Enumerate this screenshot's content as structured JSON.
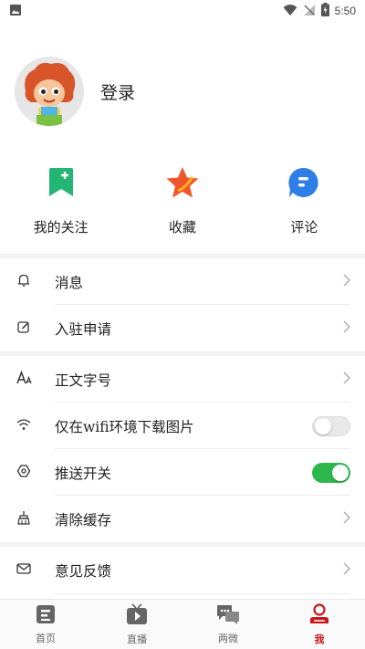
{
  "status": {
    "time": "5:50"
  },
  "profile": {
    "login_label": "登录"
  },
  "quick_actions": [
    {
      "label": "我的关注",
      "icon": "bookmark-plus-icon",
      "color": "#22b573"
    },
    {
      "label": "收藏",
      "icon": "star-icon",
      "color": "#f0552b"
    },
    {
      "label": "评论",
      "icon": "comment-icon",
      "color": "#2d7ee6"
    }
  ],
  "menu": {
    "messages": {
      "label": "消息",
      "icon": "bell-icon"
    },
    "settle": {
      "label": "入驻申请",
      "icon": "edit-icon"
    },
    "font_size": {
      "label": "正文字号",
      "icon": "font-size-icon"
    },
    "wifi_images": {
      "label": "仅在wifi环境下载图片",
      "icon": "wifi-icon",
      "enabled": false
    },
    "push": {
      "label": "推送开关",
      "icon": "hexagon-icon",
      "enabled": true
    },
    "clear_cache": {
      "label": "清除缓存",
      "icon": "broom-icon"
    },
    "feedback": {
      "label": "意见反馈",
      "icon": "mail-icon"
    }
  },
  "tabs": [
    {
      "label": "首页",
      "icon": "home-icon",
      "active": false
    },
    {
      "label": "直播",
      "icon": "tv-play-icon",
      "active": false
    },
    {
      "label": "两微",
      "icon": "chat-bubbles-icon",
      "active": false
    },
    {
      "label": "我",
      "icon": "user-icon",
      "active": true
    }
  ],
  "colors": {
    "accent_red": "#c8161d",
    "toggle_on": "#2db84d"
  }
}
